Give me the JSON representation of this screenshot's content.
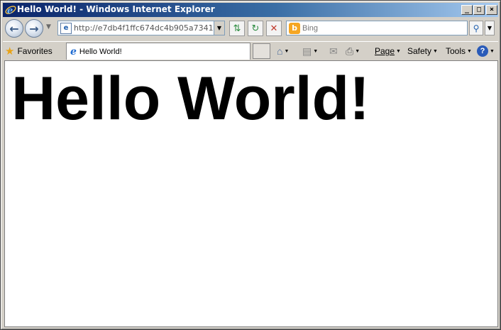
{
  "window": {
    "title": "Hello World! - Windows Internet Explorer",
    "icon": "ie-logo-icon",
    "controls": {
      "minimize": "_",
      "maximize": "□",
      "close": "×"
    }
  },
  "addressbar": {
    "url": "http://e7db4f1ffc674dc4b905a73410...",
    "back_icon": "back-arrow-icon",
    "forward_icon": "forward-arrow-icon"
  },
  "search": {
    "placeholder": "Bing",
    "provider_icon": "bing-icon"
  },
  "commandbar": {
    "favorites_label": "Favorites",
    "tab_title": "Hello World!",
    "page_label": "Page",
    "safety_label": "Safety",
    "tools_label": "Tools",
    "help_glyph": "?"
  },
  "content": {
    "heading": "Hello World!"
  },
  "colors": {
    "titlebar_start": "#0a246a",
    "titlebar_end": "#a6caf0",
    "chrome": "#d4d0c8",
    "page_bg": "#ffffff"
  }
}
